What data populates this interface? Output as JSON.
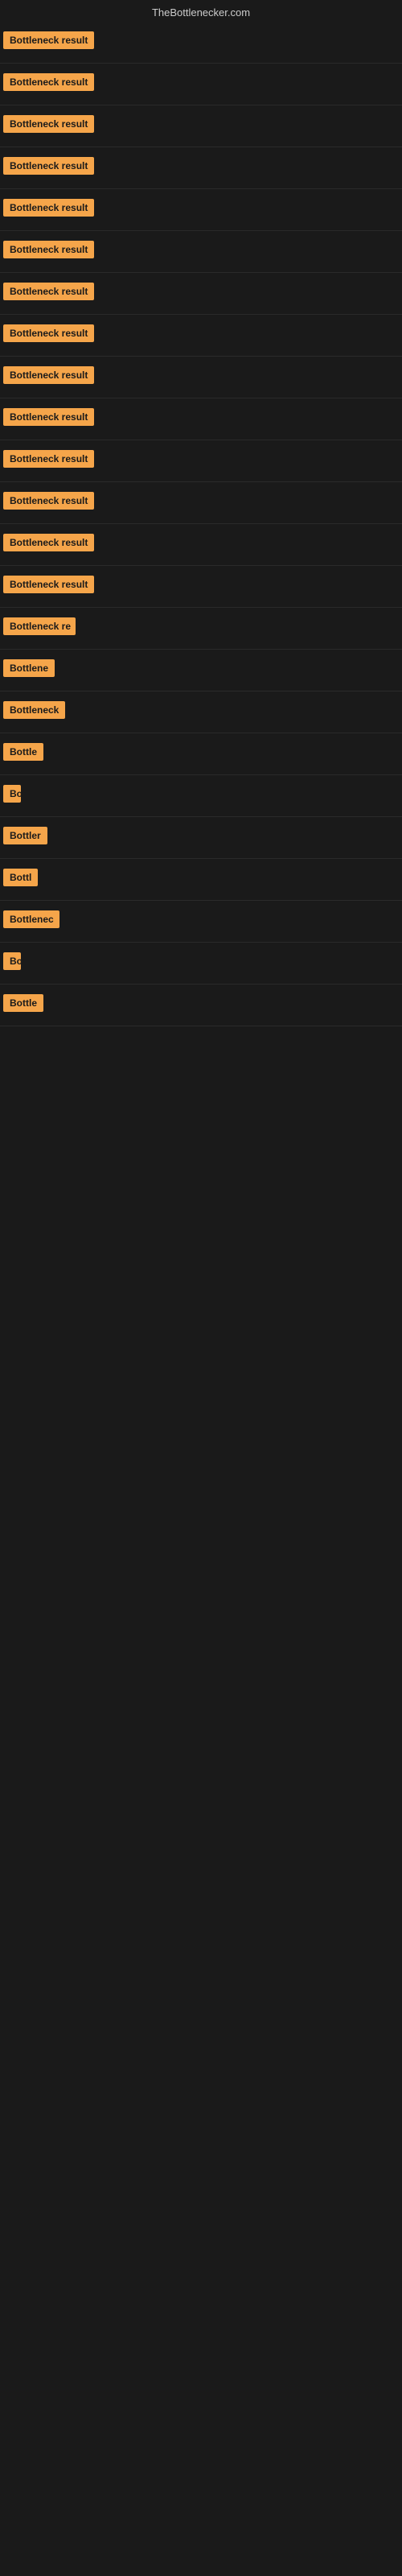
{
  "header": {
    "site_name": "TheBottlenecker.com"
  },
  "badges": [
    {
      "id": 1,
      "label": "Bottleneck result",
      "truncated": false
    },
    {
      "id": 2,
      "label": "Bottleneck result",
      "truncated": false
    },
    {
      "id": 3,
      "label": "Bottleneck result",
      "truncated": false
    },
    {
      "id": 4,
      "label": "Bottleneck result",
      "truncated": false
    },
    {
      "id": 5,
      "label": "Bottleneck result",
      "truncated": false
    },
    {
      "id": 6,
      "label": "Bottleneck result",
      "truncated": false
    },
    {
      "id": 7,
      "label": "Bottleneck result",
      "truncated": false
    },
    {
      "id": 8,
      "label": "Bottleneck result",
      "truncated": false
    },
    {
      "id": 9,
      "label": "Bottleneck result",
      "truncated": false
    },
    {
      "id": 10,
      "label": "Bottleneck result",
      "truncated": false
    },
    {
      "id": 11,
      "label": "Bottleneck result",
      "truncated": false
    },
    {
      "id": 12,
      "label": "Bottleneck result",
      "truncated": false
    },
    {
      "id": 13,
      "label": "Bottleneck result",
      "truncated": false
    },
    {
      "id": 14,
      "label": "Bottleneck result",
      "truncated": false
    },
    {
      "id": 15,
      "label": "Bottleneck re",
      "truncated": true
    },
    {
      "id": 16,
      "label": "Bottlene",
      "truncated": true
    },
    {
      "id": 17,
      "label": "Bottleneck",
      "truncated": true
    },
    {
      "id": 18,
      "label": "Bottle",
      "truncated": true
    },
    {
      "id": 19,
      "label": "Bo",
      "truncated": true
    },
    {
      "id": 20,
      "label": "Bottler",
      "truncated": true
    },
    {
      "id": 21,
      "label": "Bottl",
      "truncated": true
    },
    {
      "id": 22,
      "label": "Bottlenec",
      "truncated": true
    },
    {
      "id": 23,
      "label": "Bo",
      "truncated": true
    },
    {
      "id": 24,
      "label": "Bottle",
      "truncated": true
    }
  ],
  "colors": {
    "badge_bg": "#f5a54a",
    "badge_text": "#1a1a1a",
    "bg": "#1a1a1a",
    "header_text": "#cccccc"
  }
}
